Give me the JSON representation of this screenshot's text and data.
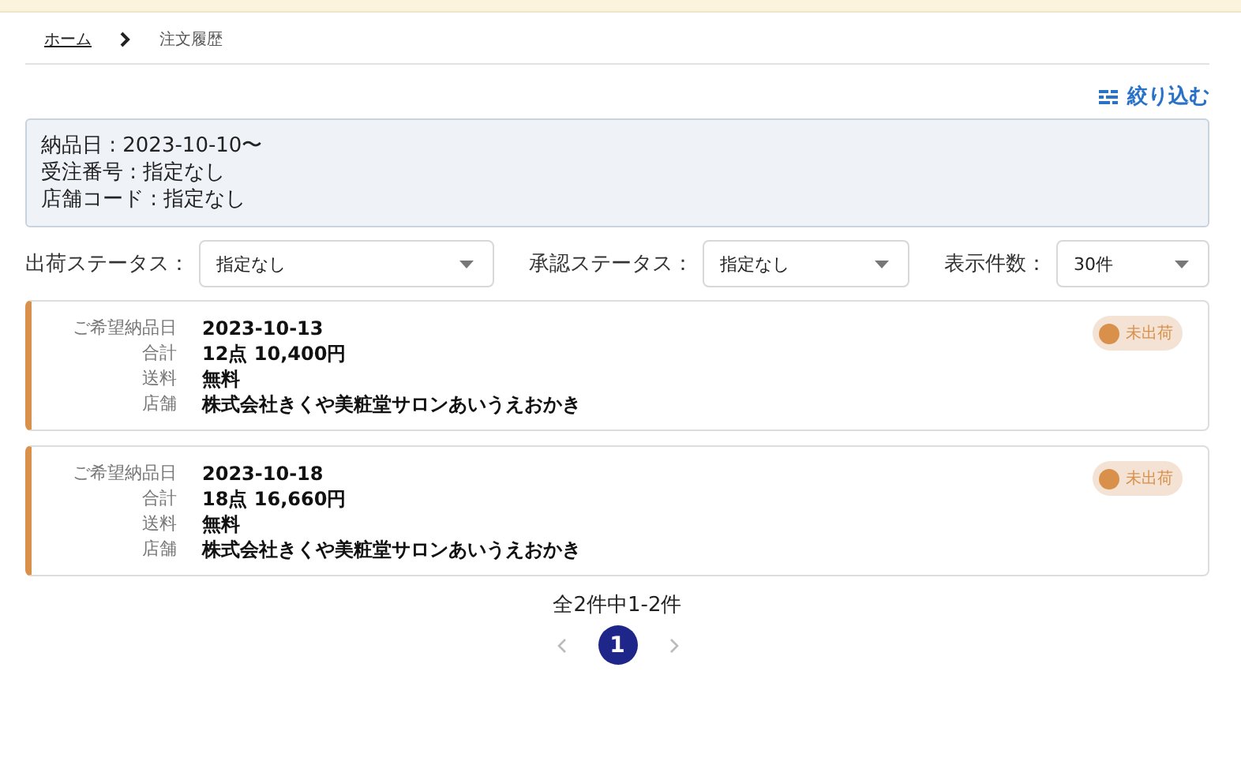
{
  "breadcrumb": [
    {
      "label": "ホーム",
      "link": true
    },
    {
      "label": "注文履歴",
      "link": false
    }
  ],
  "filter_button": {
    "label": "絞り込む"
  },
  "summary": [
    "納品日 : 2023-10-10〜",
    "受注番号 : 指定なし",
    "店舗コード : 指定なし"
  ],
  "selects": [
    {
      "label": "出荷ステータス：",
      "value": "指定なし"
    },
    {
      "label": "承認ステータス：",
      "value": "指定なし"
    },
    {
      "label": "表示件数：",
      "value": "30件"
    }
  ],
  "orders": [
    {
      "fields": [
        {
          "label": "ご希望納品日",
          "value": "2023-10-13"
        },
        {
          "label": "合計",
          "value": "12点 10,400円"
        },
        {
          "label": "送料",
          "value": "無料"
        },
        {
          "label": "店舗",
          "value": "株式会社きくや美粧堂サロンあいうえおかき"
        }
      ],
      "status": {
        "label": "未出荷",
        "color": "#d9904a"
      }
    },
    {
      "fields": [
        {
          "label": "ご希望納品日",
          "value": "2023-10-18"
        },
        {
          "label": "合計",
          "value": "18点 16,660円"
        },
        {
          "label": "送料",
          "value": "無料"
        },
        {
          "label": "店舗",
          "value": "株式会社きくや美粧堂サロンあいうえおかき"
        }
      ],
      "status": {
        "label": "未出荷",
        "color": "#d9904a"
      }
    }
  ],
  "pagination": {
    "summary": "全2件中1-2件",
    "pages": [
      {
        "label": "1",
        "selected": true
      }
    ],
    "prev_disabled": true,
    "next_disabled": true
  }
}
